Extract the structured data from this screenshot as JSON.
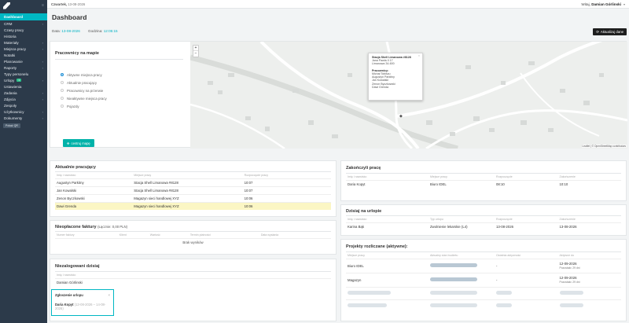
{
  "sidebar": {
    "items": [
      {
        "label": "Dashboard",
        "active": true
      },
      {
        "label": "CRM",
        "sub": true
      },
      {
        "label": "Czasy pracy"
      },
      {
        "label": "Historia"
      },
      {
        "label": "Materiały",
        "sub": true
      },
      {
        "label": "Miejsca pracy",
        "sub": true
      },
      {
        "label": "Notatki"
      },
      {
        "label": "Planowanie",
        "sub": true
      },
      {
        "label": "Raporty",
        "sub": true
      },
      {
        "label": "Typy personelu"
      },
      {
        "label": "Urlopy",
        "badge": "1",
        "sub": true
      },
      {
        "label": "Ustawienia"
      },
      {
        "label": "Zadania",
        "sub": true
      },
      {
        "label": "Zdjęcia",
        "sub": true
      },
      {
        "label": "Zespoły"
      },
      {
        "label": "Użytkownicy",
        "sub": true
      },
      {
        "label": "Dokumenty",
        "sub": true
      }
    ],
    "footer_pill": "Pokaż QR"
  },
  "topbar": {
    "date_day": "Czwartek,",
    "date_value": "13-08-2026",
    "greeting": "Witaj,",
    "user_name": "Damian Górlinski"
  },
  "page": {
    "title": "Dashboard",
    "date_label": "Data:",
    "date_value": "13-08-2026",
    "time_label": "Godzina:",
    "time_value": "12:05:15",
    "refresh_label": "Aktualizuj dane"
  },
  "map_panel": {
    "title": "Pracownicy na mapie",
    "options": [
      {
        "label": "Aktywne miejsca pracy",
        "checked": true
      },
      {
        "label": "Aktualnie pracujący",
        "checked": false
      },
      {
        "label": "Pracownicy na przerwie",
        "checked": false
      },
      {
        "label": "Nieaktywne miejsca pracy",
        "checked": false
      },
      {
        "label": "Pojazdy",
        "checked": false
      }
    ],
    "center_button": "centruj mapę",
    "zoom_in": "+",
    "zoom_out": "−",
    "attribution": "Leaflet | © OpenStreetMap contributors",
    "popup": {
      "title": "Stacja Shell Limanowa #8128",
      "address1": "Jana Pawła II 17",
      "address2": "Limanowa 34-600",
      "workers_label": "Pracownicy:",
      "workers": [
        "Michał Tobiszu",
        "Augustyn Parkitny",
        "Jan Kowalski",
        "Zenon Byczkowski",
        "Dawi Grenda"
      ]
    }
  },
  "working_now": {
    "title": "Aktualnie pracujący",
    "columns": [
      "Imię i nazwisko",
      "Miejsce pracy",
      "Rozpoczęcie pracy"
    ],
    "rows": [
      {
        "name": "Augustyn Parkitny",
        "place": "Stacja Shell Limanowa #8128",
        "start": "10:07",
        "hl": false
      },
      {
        "name": "Jan Kowalski",
        "place": "Stacja Shell Limanowa #8128",
        "start": "10:07",
        "hl": false
      },
      {
        "name": "Zenon Byczkowski",
        "place": "Magazyn sieci handlowej XYZ",
        "start": "10:06",
        "hl": false
      },
      {
        "name": "Dawi Grenda",
        "place": "Magazyn sieci handlowej XYZ",
        "start": "10:06",
        "hl": true
      }
    ]
  },
  "unpaid": {
    "title": "Nieopłacone faktury",
    "summary": "(Łącznie: 0,00 PLN)",
    "columns": [
      "Numer faktury",
      "Klient",
      "Wartość",
      "Termin płatności",
      "Data wysłania"
    ],
    "empty": "Brak wyników"
  },
  "not_logged": {
    "title": "Niezalogowani dzisiaj",
    "columns": [
      "Imię i nazwisko"
    ],
    "rows": [
      "Damian Górlinski"
    ]
  },
  "toast": {
    "title": "Zgłoszenie urlopu",
    "name": "Daria Kopyt",
    "dates": "(13-08-2026 – 14-08-2026)"
  },
  "finished": {
    "title": "Zakończyli pracę",
    "columns": [
      "Imię i nazwisko",
      "Miejsce pracy",
      "Rozpoczęcie",
      "Zakończenie"
    ],
    "rows": [
      {
        "name": "Daria Kopyt",
        "place": "Biuro IDEL",
        "start": "08:10",
        "end": "10:10"
      }
    ]
  },
  "on_leave": {
    "title": "Dzisiaj na urlopie",
    "columns": [
      "Imię i nazwisko",
      "Typ urlopu",
      "Rozpoczęcie",
      "Zakończenie"
    ],
    "rows": [
      {
        "name": "Karina Bąk",
        "type": "Zwolnienie lekarskie (L4)",
        "start": "13-08-2026",
        "end": "13-08-2026"
      }
    ]
  },
  "projects": {
    "title": "Projekty rozliczane (aktywne):",
    "columns": [
      "Miejsce pracy",
      "Aktualny stan budżetu",
      "Ostatnia aktywność",
      "Aktywne do"
    ],
    "rows": [
      {
        "place": "Biuro IDEL",
        "budget": 0.55,
        "last": "-",
        "until": "12-09-2026",
        "note": "Pozostało: 29 dni"
      },
      {
        "place": "Magazyn",
        "budget": 0.55,
        "last": "-",
        "until": "12-09-2026",
        "note": "Pozostało: 29 dni"
      },
      {
        "place": "",
        "budget": 0.0,
        "last": "",
        "until": "",
        "note": ""
      },
      {
        "place": "",
        "budget": 0.0,
        "last": "",
        "until": "",
        "note": ""
      }
    ]
  }
}
